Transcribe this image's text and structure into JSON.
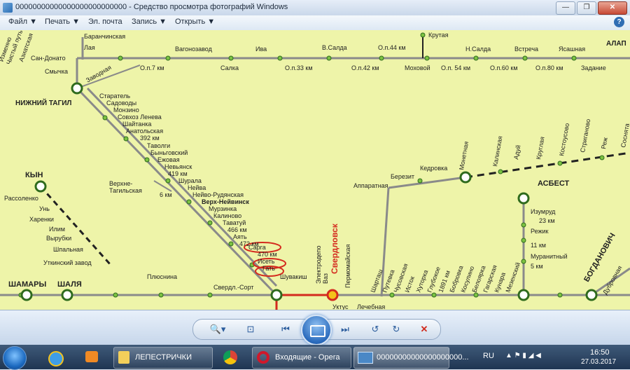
{
  "window": {
    "title": "00000000000000000000000000 - Средство просмотра фотографий Windows",
    "buttons": [
      "—",
      "❐",
      "✕"
    ]
  },
  "menu": {
    "file": "Файл ▼",
    "print": "Печать ▼",
    "email": "Эл. почта",
    "burn": "Запись ▼",
    "open": "Открыть ▼",
    "help": "?"
  },
  "map": {
    "left_top_labels": [
      "Изменно",
      "Чистый путь",
      "Азиатская"
    ],
    "labels": {
      "baranchinskaya": "Баранчинская",
      "laya": "Лая",
      "san_donato": "Сан-Донато",
      "smychka": "Смычка",
      "zavodnaya": "Заводная",
      "nizhny_tagil": "НИЖНИЙ ТАГИЛ",
      "vagonozavod": "Вагонозавод",
      "iva": "Ива",
      "v_salda": "В.Салда",
      "op44": "О.п.44 км",
      "krutaya": "Крутая",
      "n_salda": "Н.Салда",
      "vstrecha": "Встреча",
      "yasashnaya": "Ясашная",
      "alap": "АЛАП",
      "op7": "О.п.7 км",
      "salka": "Салка",
      "op33": "О.п.33 км",
      "op42": "О.п.42 км",
      "mokhovoy": "Моховой",
      "op54": "О.п. 54 км",
      "op60": "О.п.60 км",
      "op80": "О.п.80 км",
      "zadanie": "Задание",
      "starotel": "Старатель",
      "sadovody": "Садоводы",
      "monzino": "Монзино",
      "sovkhoz_leneva": "Совхоз Ленева",
      "shaitanka": "Шайтанка",
      "anatolskaya": "Анатольская",
      "km392": "392 км",
      "tavolgi": "Таволги",
      "bynogovsky": "Быньговский",
      "ezhovaya": "Ежовая",
      "nevyansk": "Невьянск",
      "km419": "419 км",
      "shurala": "Шурала",
      "neiva": "Нейва",
      "neivo_rudyanskaya": "Нейво-Рудянская",
      "verkh_neyvinsk": "Верх-Нейвинск",
      "murzinka": "Мурзинка",
      "kalinovo": "Калиново",
      "tavatuy": "Таватуй",
      "km466": "466 км",
      "ayat": "Аять",
      "km472": "472 км",
      "sarga": "Сарга",
      "km470": "470 км",
      "iset": "Исеть",
      "gat": "Гать",
      "shuvakish": "Шувакиш",
      "verkhne_tagilskaya_1": "Верхне-",
      "verkhne_tagilskaya_2": "Тагильская",
      "km6": "6 км",
      "kyn": "КЫН",
      "rassolenko": "Рассоленко",
      "un": "Унь",
      "kharenki": "Харенки",
      "ilim": "Илим",
      "vyruby": "Вырубки",
      "shpalnaya": "Шпальная",
      "utkinsky_zavod": "Уткинский завод",
      "shamary": "ШАМАРЫ",
      "shalya": "ШАЛЯ",
      "plyusnina": "Плюснина",
      "sverdl_sort": "Свердл.-Сорт",
      "sverdlovsk": "Свердловск",
      "elektrodepo": "Электродепо",
      "vaz": "Ваз",
      "permskaya": "Пермомайская",
      "uktus": "Уктус",
      "lechebnaya": "Лечебная",
      "apparatnaya": "Аппаратная",
      "berezit": "Березит",
      "kedrovka": "Кедровка",
      "monetnaya": "Монетная",
      "kalinskaya": "Калинская",
      "adui": "Адуй",
      "kruglaya": "Круглая",
      "kostousovo": "Костоусово",
      "striganovo": "Стриганово",
      "rezh": "Реж",
      "sosnyata": "Соснята",
      "asbest": "АСБЕСТ",
      "izumrud": "Изумруд",
      "km23": "23 км",
      "rezhik": "Режик",
      "km11": "11 км",
      "muraninny": "Муранитный",
      "km5": "5 км",
      "bogdanovich": "БОГДАНОВИЧ",
      "dubrovnaya": "Дубровная"
    },
    "slanted_lower": [
      "Шарташ",
      "Путевка",
      "Чусовская",
      "Исток",
      "Хуторка",
      "Глубокое",
      "1891 км",
      "Бобровка",
      "Косулино",
      "Белоярка",
      "Гагарская",
      "Кунара",
      "Мезенский"
    ]
  },
  "navbar": {
    "zoom": "🔍▾",
    "fit": "⊡",
    "prev": "⏮",
    "next": "⏭",
    "rotate_left": "↺",
    "rotate_right": "↻",
    "delete": "✕"
  },
  "taskbar": {
    "folder_label": "ЛЕПЕСТРИЧКИ",
    "opera_label": "Входящие - Opera",
    "viewer_label": "00000000000000000000...",
    "lang": "RU",
    "time": "16:50",
    "date": "27.03.2017"
  }
}
